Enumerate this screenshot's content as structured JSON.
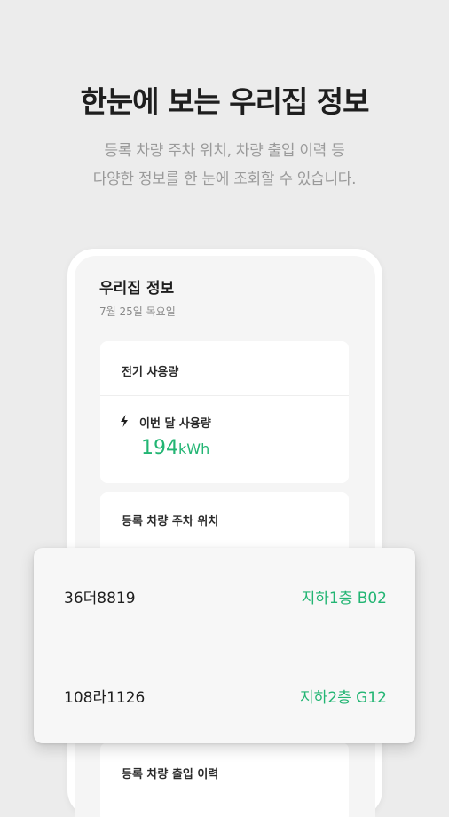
{
  "headline": "한눈에 보는 우리집 정보",
  "subtext": {
    "line1": "등록 차량 주차 위치, 차량 출입 이력 등",
    "line2": "다양한 정보를 한 눈에 조회할 수 있습니다."
  },
  "screen": {
    "title": "우리집 정보",
    "date": "7월 25일 목요일",
    "electricity": {
      "title": "전기 사용량",
      "usage_label": "이번 달 사용량",
      "usage_value": "194",
      "usage_unit": "kWh",
      "icon": "lightning-icon"
    },
    "parking": {
      "title": "등록 차량 주차 위치"
    },
    "entry_history": {
      "title": "등록 차량 출입 이력"
    }
  },
  "vehicles": [
    {
      "plate": "36더8819",
      "location": "지하1층 B02"
    },
    {
      "plate": "108라1126",
      "location": "지하2층 G12"
    }
  ],
  "colors": {
    "accent": "#22b573",
    "background": "#ececec",
    "card": "#ffffff"
  }
}
